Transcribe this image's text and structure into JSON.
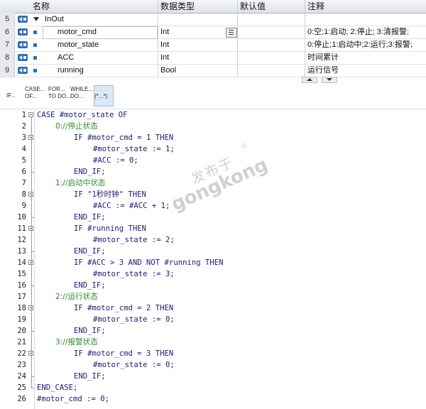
{
  "table": {
    "headers": {
      "name": "名称",
      "datatype": "数据类型",
      "default": "默认值",
      "comment": "注释"
    },
    "rows": [
      {
        "num": "5",
        "name": "InOut",
        "datatype": "",
        "comment": ""
      },
      {
        "num": "6",
        "name": "motor_cmd",
        "datatype": "Int",
        "comment": "0:空;1:启动; 2:停止; 3:清报警;"
      },
      {
        "num": "7",
        "name": "motor_state",
        "datatype": "Int",
        "comment": "0:停止;1:启动中;2:运行;3:报警;"
      },
      {
        "num": "8",
        "name": "ACC",
        "datatype": "Int",
        "comment": "时间累计"
      },
      {
        "num": "9",
        "name": "running",
        "datatype": "Bool",
        "comment": "运行信号"
      }
    ]
  },
  "toolbar": {
    "if_label": "IF...",
    "case_label_1": "CASE...",
    "case_label_2": "OF...",
    "for_label_1": "FOR...",
    "for_label_2": "TO DO...",
    "while_label_1": "WHILE...",
    "while_label_2": "DO...",
    "comment_label": "(*...*)"
  },
  "code": [
    {
      "n": "1",
      "indent": 0,
      "text": "CASE #motor_state OF",
      "type": "kw"
    },
    {
      "n": "2",
      "indent": 1,
      "text": "0://停止状态",
      "type": "comment"
    },
    {
      "n": "3",
      "indent": 2,
      "text": "IF #motor_cmd = 1 THEN",
      "type": "kw"
    },
    {
      "n": "4",
      "indent": 3,
      "text": "#motor_state := 1;",
      "type": "kw"
    },
    {
      "n": "5",
      "indent": 3,
      "text": "#ACC := 0;",
      "type": "kw"
    },
    {
      "n": "6",
      "indent": 2,
      "text": "END_IF;",
      "type": "kw"
    },
    {
      "n": "7",
      "indent": 1,
      "text": "1://启动中状态",
      "type": "comment"
    },
    {
      "n": "8",
      "indent": 2,
      "text": "IF \"1秒时钟\" THEN",
      "type": "kw"
    },
    {
      "n": "9",
      "indent": 3,
      "text": "#ACC := #ACC + 1;",
      "type": "kw"
    },
    {
      "n": "10",
      "indent": 2,
      "text": "END_IF;",
      "type": "kw"
    },
    {
      "n": "11",
      "indent": 2,
      "text": "IF #running THEN",
      "type": "kw"
    },
    {
      "n": "12",
      "indent": 3,
      "text": "#motor_state := 2;",
      "type": "kw"
    },
    {
      "n": "13",
      "indent": 2,
      "text": "END_IF;",
      "type": "kw"
    },
    {
      "n": "14",
      "indent": 2,
      "text": "IF #ACC > 3 AND NOT #running THEN",
      "type": "kw"
    },
    {
      "n": "15",
      "indent": 3,
      "text": "#motor_state := 3;",
      "type": "kw"
    },
    {
      "n": "16",
      "indent": 2,
      "text": "END_IF;",
      "type": "kw"
    },
    {
      "n": "17",
      "indent": 1,
      "text": "2://运行状态",
      "type": "comment"
    },
    {
      "n": "18",
      "indent": 2,
      "text": "IF #motor_cmd = 2 THEN",
      "type": "kw"
    },
    {
      "n": "19",
      "indent": 3,
      "text": "#motor_state := 0;",
      "type": "kw"
    },
    {
      "n": "20",
      "indent": 2,
      "text": "END_IF;",
      "type": "kw"
    },
    {
      "n": "21",
      "indent": 1,
      "text": "3://报警状态",
      "type": "comment"
    },
    {
      "n": "22",
      "indent": 2,
      "text": "IF #motor_cmd = 3 THEN",
      "type": "kw"
    },
    {
      "n": "23",
      "indent": 3,
      "text": "#motor_state := 0;",
      "type": "kw"
    },
    {
      "n": "24",
      "indent": 2,
      "text": "END_IF;",
      "type": "kw"
    },
    {
      "n": "25",
      "indent": 0,
      "text": "END_CASE;",
      "type": "kw"
    },
    {
      "n": "26",
      "indent": 0,
      "text": "#motor_cmd := 0;",
      "type": "kw"
    }
  ],
  "watermark": {
    "line1": "发布于",
    "line2": "gongkong",
    "mark": "®"
  },
  "colors": {
    "keyword": "#1b1b7a",
    "comment": "#2d8a2d",
    "io_icon": "#2f6fb8"
  }
}
